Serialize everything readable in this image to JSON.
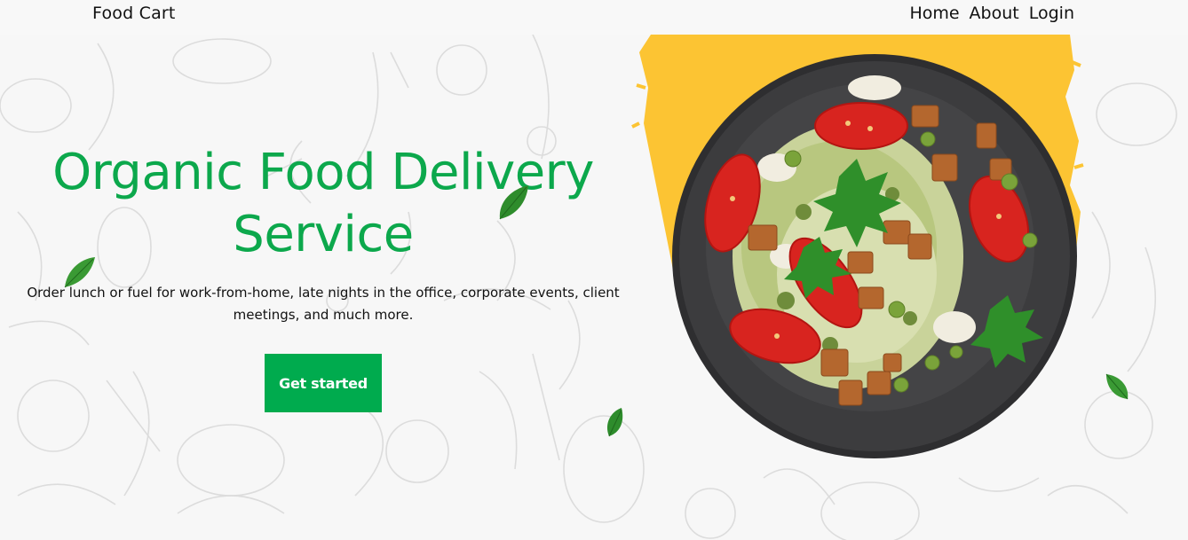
{
  "navbar": {
    "brand": "Food Cart",
    "links": [
      "Home",
      "About",
      "Login"
    ]
  },
  "hero": {
    "title_line1": "Organic Food Delivery",
    "title_line2": "Service",
    "description": "Order lunch or fuel for work-from-home, late nights in the office, corporate events, client meetings, and much more.",
    "cta_label": "Get started"
  },
  "colors": {
    "accent": "#0ca84c",
    "button": "#00ab4e",
    "brush_yellow": "#fcc433",
    "plate": "#3a3a3c"
  },
  "icons": [
    "leaf-icon"
  ]
}
